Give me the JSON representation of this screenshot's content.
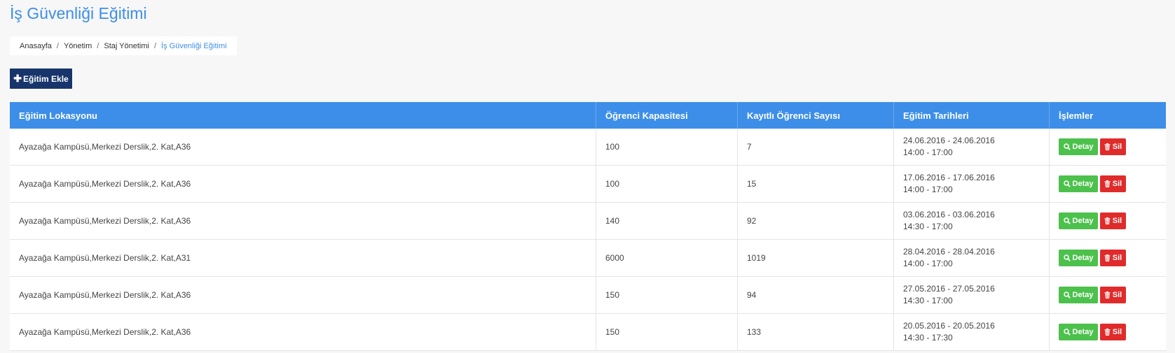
{
  "page": {
    "title": "İş Güvenliği Eğitimi"
  },
  "breadcrumb": {
    "items": [
      "Anasayfa",
      "Yönetim",
      "Staj Yönetimi"
    ],
    "active": "İş Güvenliği Eğitimi",
    "separator": "/"
  },
  "toolbar": {
    "add_label": "Eğitim Ekle",
    "add_icon": "plus-icon"
  },
  "table": {
    "headers": [
      "Eğitim Lokasyonu",
      "Öğrenci Kapasitesi",
      "Kayıtlı Öğrenci Sayısı",
      "Eğitim Tarihleri",
      "İşlemler"
    ],
    "rows": [
      {
        "location": "Ayazağa Kampüsü,Merkezi Derslik,2. Kat,A36",
        "capacity": "100",
        "registered": "7",
        "dates": "24.06.2016 - 24.06.2016",
        "time": "14:00 - 17:00"
      },
      {
        "location": "Ayazağa Kampüsü,Merkezi Derslik,2. Kat,A36",
        "capacity": "100",
        "registered": "15",
        "dates": "17.06.2016 - 17.06.2016",
        "time": "14:00 - 17:00"
      },
      {
        "location": "Ayazağa Kampüsü,Merkezi Derslik,2. Kat,A36",
        "capacity": "140",
        "registered": "92",
        "dates": "03.06.2016 - 03.06.2016",
        "time": "14:30 - 17:00"
      },
      {
        "location": "Ayazağa Kampüsü,Merkezi Derslik,2. Kat,A31",
        "capacity": "6000",
        "registered": "1019",
        "dates": "28.04.2016 - 28.04.2016",
        "time": "14:00 - 17:00"
      },
      {
        "location": "Ayazağa Kampüsü,Merkezi Derslik,2. Kat,A36",
        "capacity": "150",
        "registered": "94",
        "dates": "27.05.2016 - 27.05.2016",
        "time": "14:30 - 17:00"
      },
      {
        "location": "Ayazağa Kampüsü,Merkezi Derslik,2. Kat,A36",
        "capacity": "150",
        "registered": "133",
        "dates": "20.05.2016 - 20.05.2016",
        "time": "14:30 - 17:30"
      }
    ],
    "actions": {
      "detail_label": "Detay",
      "detail_icon": "search-icon",
      "delete_label": "Sil",
      "delete_icon": "trash-icon"
    }
  },
  "colors": {
    "accent": "#3d8ee8",
    "primary_button": "#17356b",
    "detail_button": "#4cc14c",
    "delete_button": "#e02b2b",
    "background": "#f7f7f7"
  }
}
